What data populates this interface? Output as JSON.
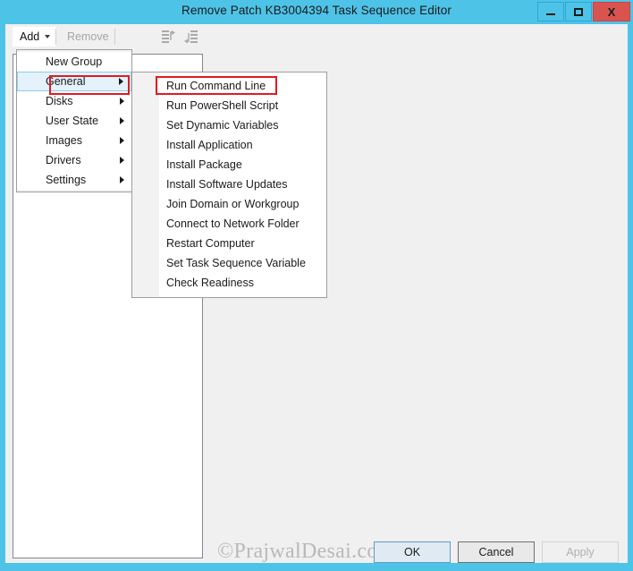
{
  "window": {
    "title": "Remove Patch KB3004394 Task Sequence Editor",
    "controls": {
      "minimize": "minimize-button",
      "maximize": "maximize-button",
      "close": "X"
    },
    "frame_color": "#4ec3e8",
    "close_color": "#d9534f"
  },
  "toolbar": {
    "add_label": "Add",
    "remove_label": "Remove",
    "icons": [
      "move-up-icon",
      "move-down-icon"
    ]
  },
  "menu": {
    "items": [
      {
        "label": "New Group",
        "has_submenu": false,
        "selected": false
      },
      {
        "label": "General",
        "has_submenu": true,
        "selected": true
      },
      {
        "label": "Disks",
        "has_submenu": true,
        "selected": false
      },
      {
        "label": "User State",
        "has_submenu": true,
        "selected": false
      },
      {
        "label": "Images",
        "has_submenu": true,
        "selected": false
      },
      {
        "label": "Drivers",
        "has_submenu": true,
        "selected": false
      },
      {
        "label": "Settings",
        "has_submenu": true,
        "selected": false
      }
    ]
  },
  "submenu": {
    "items": [
      {
        "label": "Run Command Line",
        "highlighted": true
      },
      {
        "label": "Run PowerShell Script",
        "highlighted": false
      },
      {
        "label": "Set Dynamic Variables",
        "highlighted": false
      },
      {
        "label": "Install Application",
        "highlighted": false
      },
      {
        "label": "Install Package",
        "highlighted": false
      },
      {
        "label": "Install Software Updates",
        "highlighted": false
      },
      {
        "label": "Join Domain or Workgroup",
        "highlighted": false
      },
      {
        "label": "Connect to Network Folder",
        "highlighted": false
      },
      {
        "label": "Restart Computer",
        "highlighted": false
      },
      {
        "label": "Set Task Sequence Variable",
        "highlighted": false
      },
      {
        "label": "Check Readiness",
        "highlighted": false
      }
    ]
  },
  "annotation": {
    "color": "#e01b22",
    "targets": [
      "General",
      "Run Command Line"
    ]
  },
  "watermark": {
    "text": "©PrajwalDesai.com"
  },
  "footer": {
    "ok_label": "OK",
    "cancel_label": "Cancel",
    "apply_label": "Apply",
    "apply_enabled": false
  }
}
